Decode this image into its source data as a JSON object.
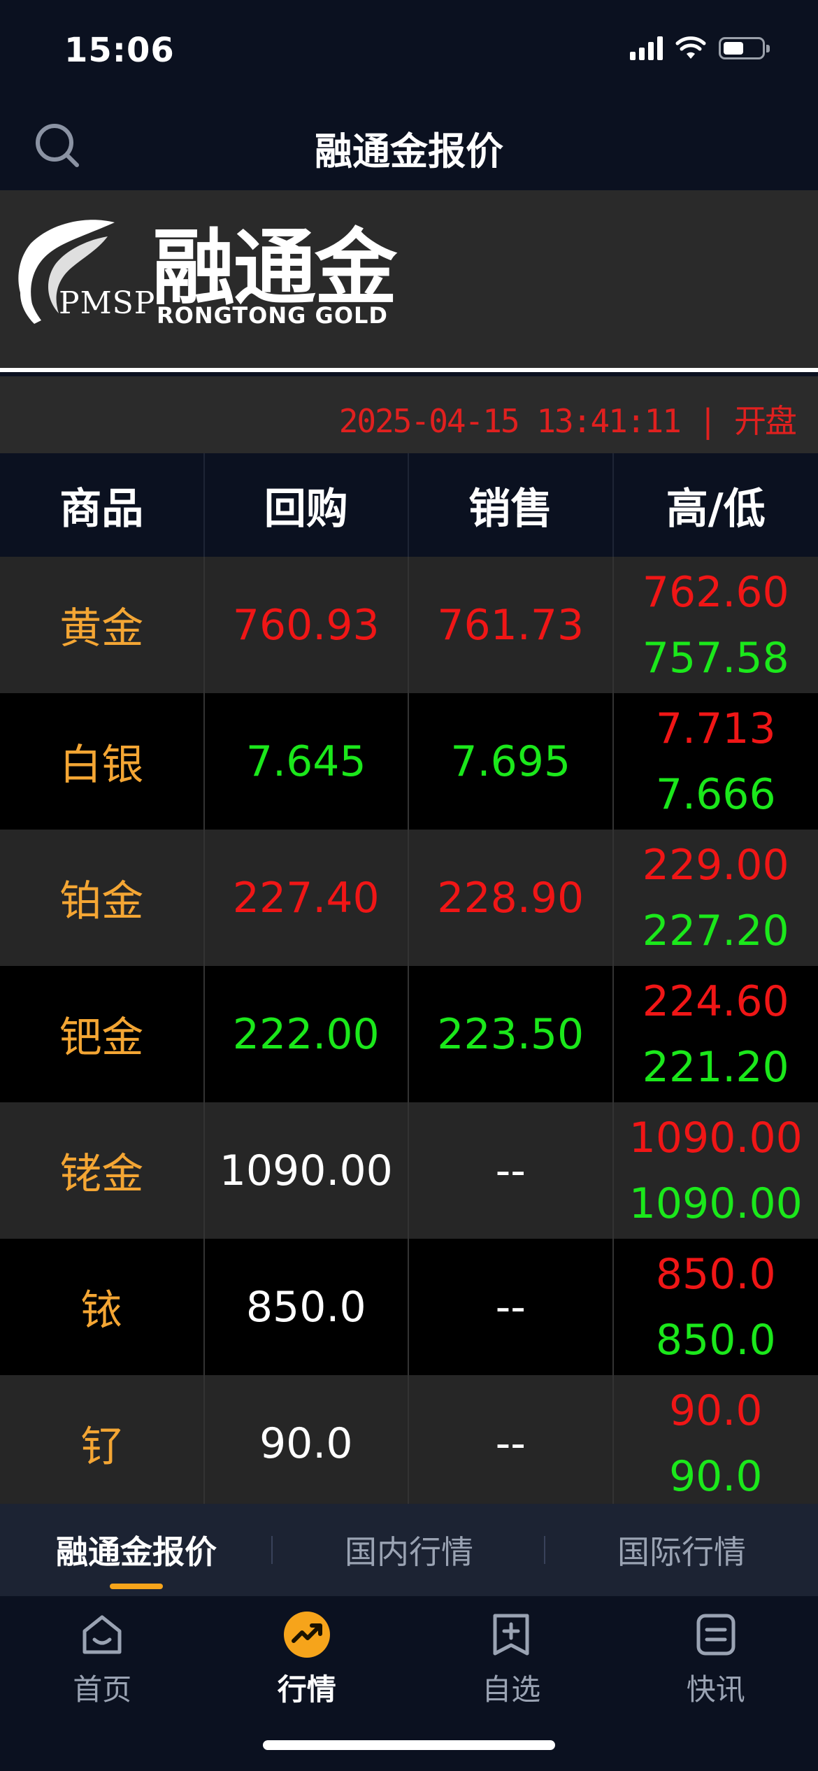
{
  "status": {
    "time": "15:06"
  },
  "header": {
    "title": "融通金报价",
    "search_icon": "search-icon"
  },
  "banner": {
    "logo_cn": "融通金",
    "logo_en": "RONGTONG GOLD",
    "logo_abbr": "PMSP"
  },
  "timestamp": {
    "text": "2025-04-15 13:41:11 | 开盘",
    "color": "#e0201f"
  },
  "table": {
    "headers": [
      "商品",
      "回购",
      "销售",
      "高/低"
    ],
    "rows": [
      {
        "name": "黄金",
        "buy": "760.93",
        "sell": "761.73",
        "high": "762.60",
        "low": "757.58"
      },
      {
        "name": "白银",
        "buy": "7.645",
        "sell": "7.695",
        "high": "7.713",
        "low": "7.666"
      },
      {
        "name": "铂金",
        "buy": "227.40",
        "sell": "228.90",
        "high": "229.00",
        "low": "227.20"
      },
      {
        "name": "钯金",
        "buy": "222.00",
        "sell": "223.50",
        "high": "224.60",
        "low": "221.20"
      },
      {
        "name": "铑金",
        "buy": "1090.00",
        "sell": "--",
        "high": "1090.00",
        "low": "1090.00"
      },
      {
        "name": "铱",
        "buy": "850.0",
        "sell": "--",
        "high": "850.0",
        "low": "850.0"
      },
      {
        "name": "钌",
        "buy": "90.0",
        "sell": "--",
        "high": "90.0",
        "low": "90.0"
      }
    ]
  },
  "colors": {
    "up": "#f01616",
    "down": "#1be81b",
    "neutral": "#ffffff",
    "commodity": "#f4a634",
    "accent": "#f6a41b"
  },
  "sub_tabs": [
    "融通金报价",
    "国内行情",
    "国际行情"
  ],
  "tab_bar": [
    {
      "label": "首页",
      "icon": "home-icon"
    },
    {
      "label": "行情",
      "icon": "market-trend-icon"
    },
    {
      "label": "自选",
      "icon": "add-watchlist-icon"
    },
    {
      "label": "快讯",
      "icon": "news-icon"
    }
  ]
}
